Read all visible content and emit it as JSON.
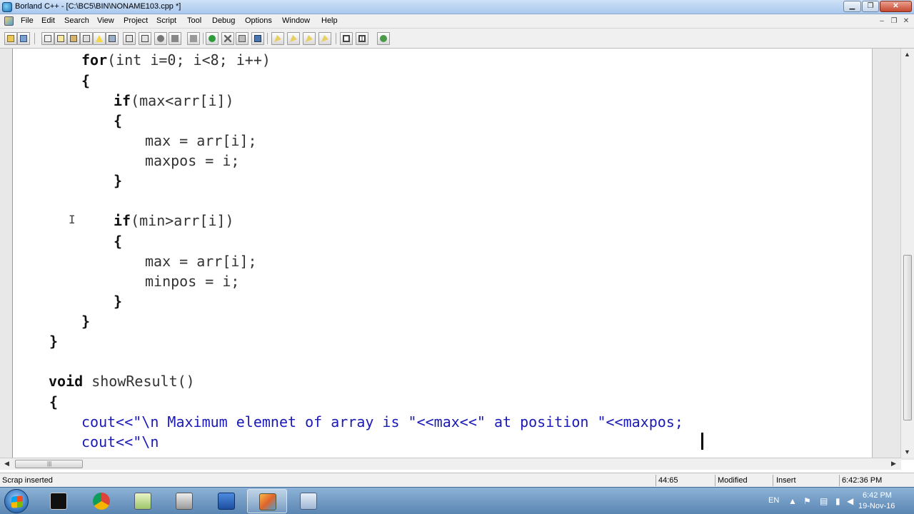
{
  "window": {
    "title": "Borland C++ - [C:\\BC5\\BIN\\NONAME103.cpp *]",
    "minimize": "▁",
    "maximize": "❐",
    "close": "✕"
  },
  "menu": {
    "items": [
      "File",
      "Edit",
      "Search",
      "View",
      "Project",
      "Script",
      "Tool",
      "Debug",
      "Options",
      "Window",
      "Help"
    ],
    "doc_controls": [
      "–",
      "❐",
      "✕"
    ]
  },
  "toolbar": {
    "icons": [
      "open-icon",
      "save-icon",
      "save-all-icon",
      "print-icon",
      "cut-icon",
      "copy-icon",
      "paste-icon",
      "make-icon",
      "build-icon",
      "compile-icon",
      "run-icon",
      "step-icon",
      "trace-icon",
      "undo-icon",
      "close-icon",
      "find-icon",
      "replace-icon",
      "breakpoint-icon",
      "watch-icon",
      "inspect-icon",
      "evaluate-icon",
      "window-icon",
      "tile-icon",
      "help-icon"
    ]
  },
  "editor": {
    "lines": [
      {
        "kw": "for",
        "rest": "(int i=0; i<8; i++)"
      },
      {
        "kw": "",
        "rest": "{"
      },
      {
        "kw": "if",
        "rest": "(max<arr[i])"
      },
      {
        "kw": "",
        "rest": "{"
      },
      {
        "kw": "",
        "rest": "max = arr[i];"
      },
      {
        "kw": "",
        "rest": "maxpos = i;"
      },
      {
        "kw": "",
        "rest": "}"
      },
      {
        "kw": "",
        "rest": ""
      },
      {
        "kw": "if",
        "rest": "(min>arr[i])"
      },
      {
        "kw": "",
        "rest": "{"
      },
      {
        "kw": "",
        "rest": "max = arr[i];"
      },
      {
        "kw": "",
        "rest": "minpos = i;"
      },
      {
        "kw": "",
        "rest": "}"
      },
      {
        "kw": "",
        "rest": "}"
      },
      {
        "kw": "",
        "rest": "}"
      },
      {
        "kw": "",
        "rest": ""
      },
      {
        "kw": "void",
        "rest": " showResult()"
      },
      {
        "kw": "",
        "rest": "{"
      },
      {
        "kw": "",
        "rest": "cout<<\"\\n Maximum elemnet of array is \"<<max<<\" at position \"<<maxpos;"
      },
      {
        "kw": "",
        "rest": "cout<<\"\\n"
      }
    ]
  },
  "statusbar": {
    "message": "Scrap inserted",
    "position": "44:65",
    "modified": "Modified",
    "mode": "Insert",
    "time": "6:42:36 PM"
  },
  "taskbar": {
    "lang": "EN",
    "clock_time": "6:42 PM",
    "clock_date": "19-Nov-16",
    "apps": [
      "cmd-icon",
      "chrome-icon",
      "notepad-icon",
      "printer-icon",
      "word-icon",
      "borland-icon",
      "calculator-icon"
    ],
    "active_app": "borland-icon"
  }
}
